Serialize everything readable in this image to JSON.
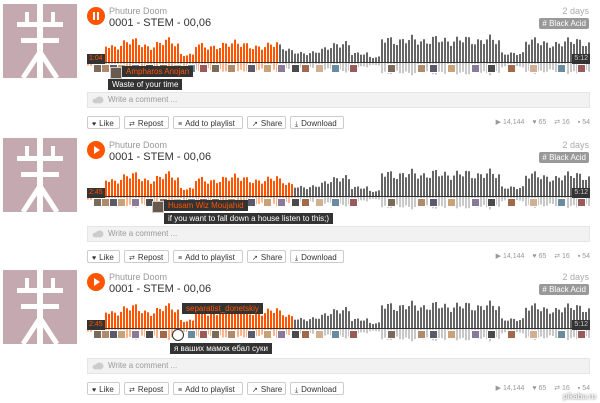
{
  "tracks": [
    {
      "artist": "Phuture Doom",
      "title": "0001 - STEM - 00,06",
      "date": "2 days",
      "tag": "# Black Acid",
      "state": "pause",
      "progress": 0.38,
      "time_left": "1:04",
      "time_right": "5:12",
      "comment_user": "Ampharos Anojan",
      "comment_text": "Waste of your time",
      "comment_placeholder": "Write a comment ...",
      "buttons": [
        "Like",
        "Repost",
        "Add to playlist",
        "Share",
        "Download"
      ],
      "stats": {
        "plays": "14,144",
        "likes": "65",
        "reposts": "16",
        "comments": "54"
      }
    },
    {
      "artist": "Phuture Doom",
      "title": "0001 - STEM - 00,06",
      "date": "2 days",
      "tag": "# Black Acid",
      "state": "play",
      "progress": 0.41,
      "time_left": "2:45",
      "time_right": "5:12",
      "comment_user": "Husam Wiz Moujahid",
      "comment_text": "if you want to fall down a house listen to this;)",
      "comment_placeholder": "Write a comment ...",
      "buttons": [
        "Like",
        "Repost",
        "Add to playlist",
        "Share",
        "Download"
      ],
      "stats": {
        "plays": "14,144",
        "likes": "65",
        "reposts": "16",
        "comments": "54"
      }
    },
    {
      "artist": "Phuture Doom",
      "title": "0001 - STEM - 00,06",
      "date": "2 days",
      "tag": "# Black Acid",
      "state": "play",
      "progress": 0.41,
      "time_left": "2:45",
      "time_right": "5:12",
      "comment_user": "separatist_donetskiy",
      "comment_text": "я ваших мамок ебал суки",
      "comment_placeholder": "Write a comment ...",
      "buttons": [
        "Like",
        "Repost",
        "Add to playlist",
        "Share",
        "Download"
      ],
      "stats": {
        "plays": "14,144",
        "likes": "65",
        "reposts": "16",
        "comments": "54"
      }
    }
  ],
  "watermark": "pikabu.ru",
  "colors": {
    "played": "#ff5500",
    "played_light": "#ffb38a",
    "unplayed": "#666666",
    "unplayed_light": "#c8c8c8",
    "bg": "#ffffff"
  },
  "icons": {
    "like": "heart-icon",
    "repost": "repost-icon",
    "playlist": "add-to-playlist-icon",
    "share": "share-icon",
    "download": "download-icon"
  }
}
